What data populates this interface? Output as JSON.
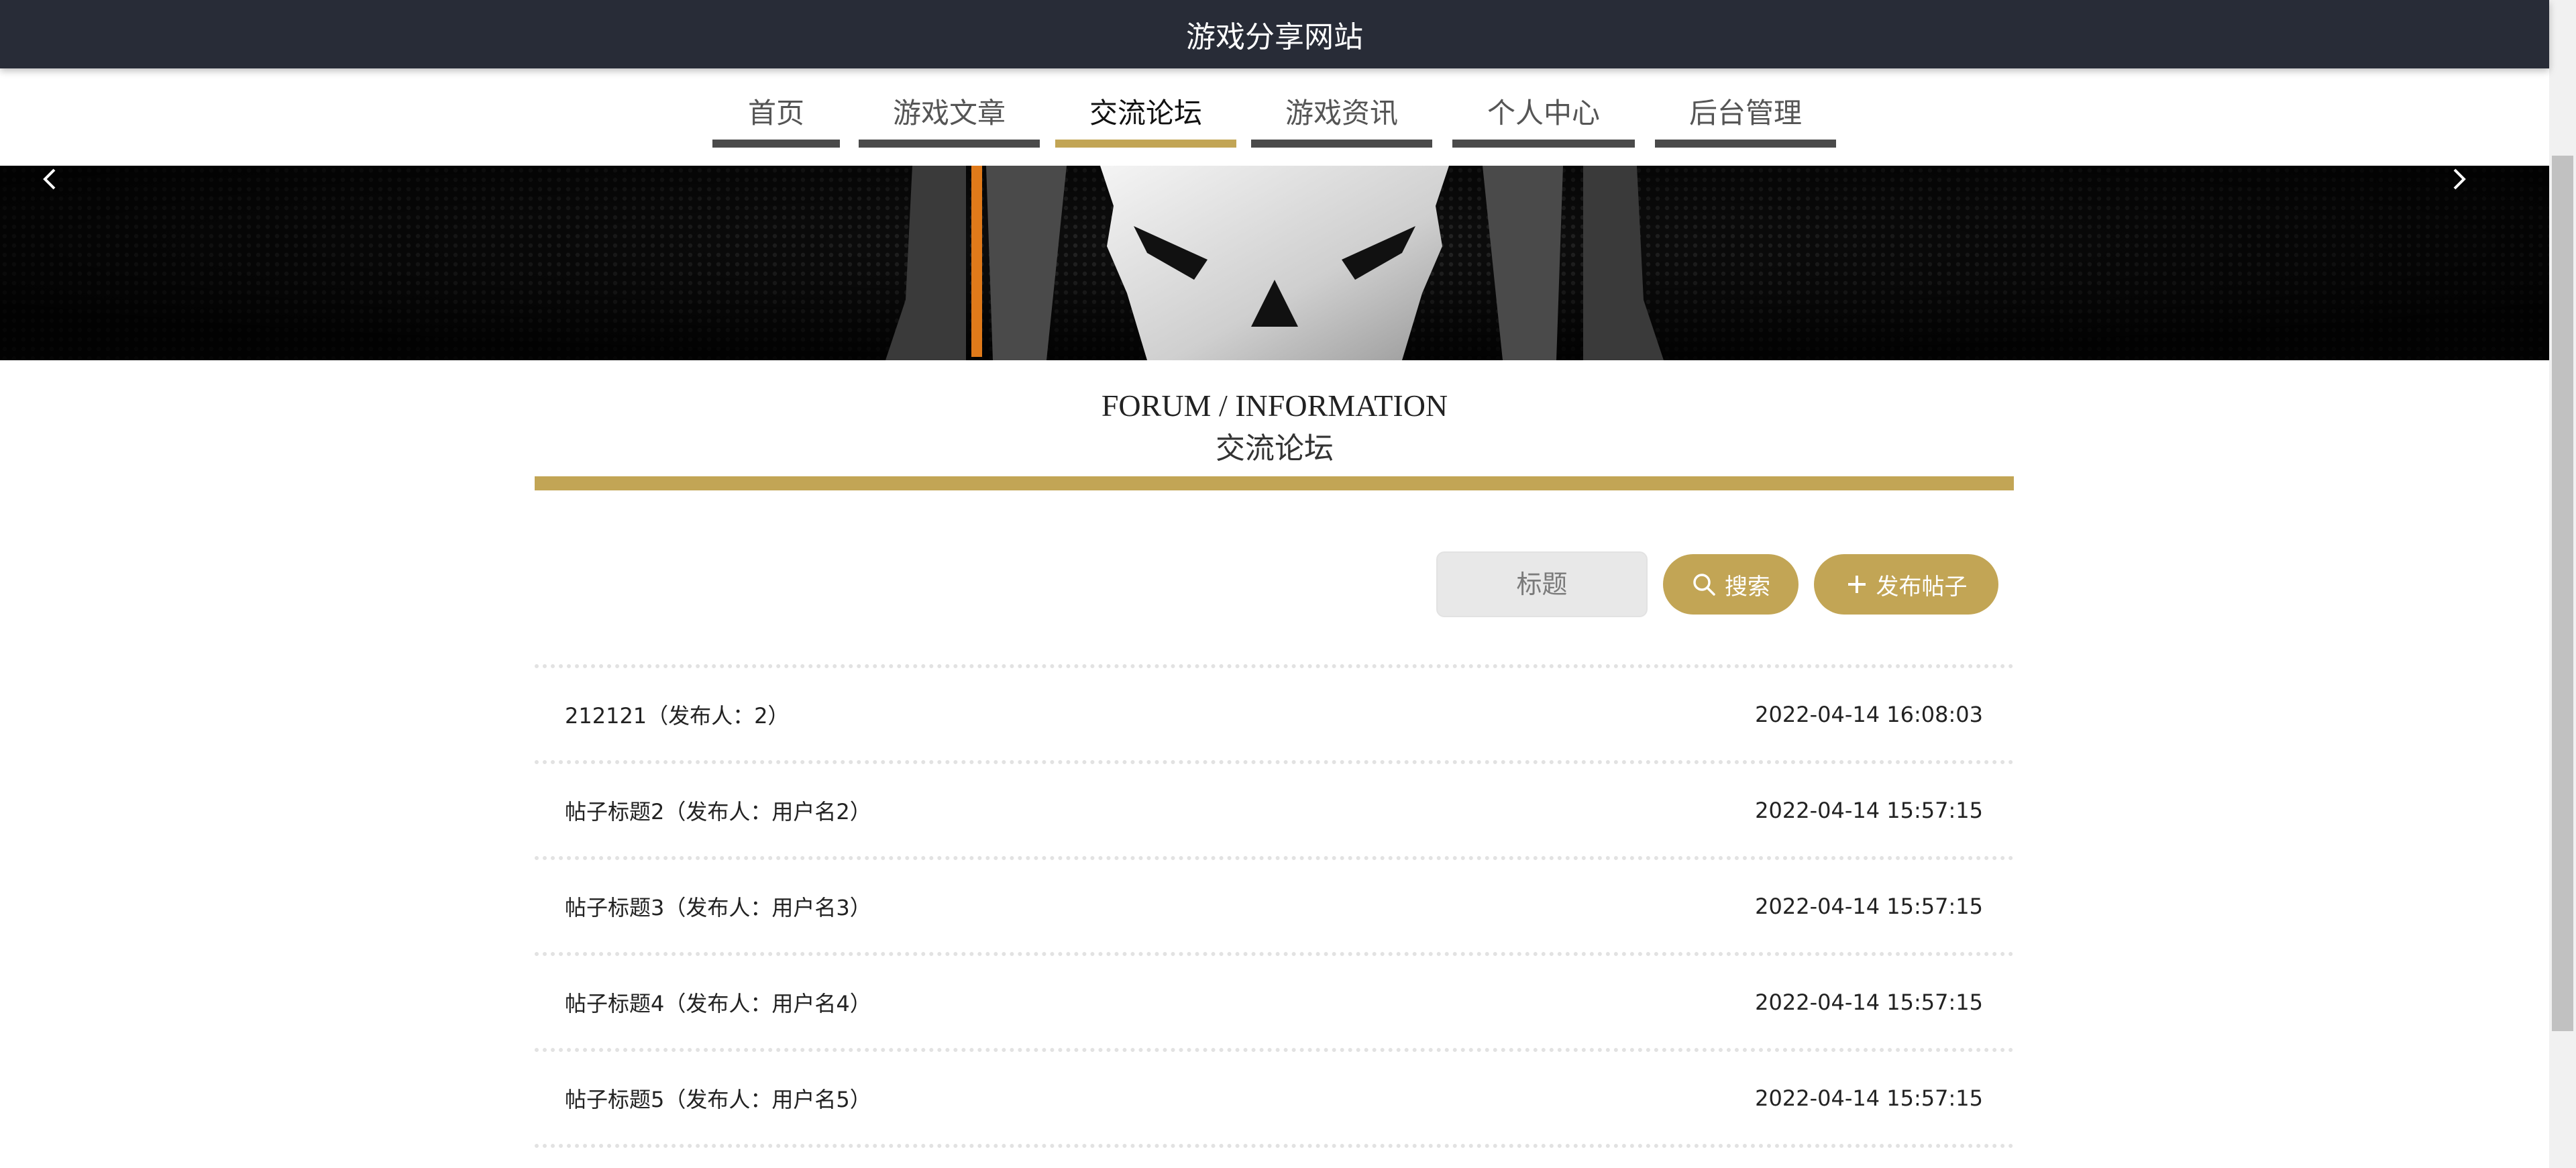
{
  "header": {
    "title": "游戏分享网站"
  },
  "nav": {
    "items": [
      {
        "label": "首页"
      },
      {
        "label": "游戏文章"
      },
      {
        "label": "交流论坛"
      },
      {
        "label": "游戏资讯"
      },
      {
        "label": "个人中心"
      },
      {
        "label": "后台管理"
      }
    ],
    "active_index": 2
  },
  "banner": {
    "prev_icon": "chevron-left-icon",
    "next_icon": "chevron-right-icon"
  },
  "section": {
    "title_en": "FORUM / INFORMATION",
    "title_cn": "交流论坛"
  },
  "search": {
    "placeholder": "标题",
    "value": "",
    "search_label": "搜索",
    "post_label": "发布帖子"
  },
  "posts": [
    {
      "title": "212121（发布人：2）",
      "time": "2022-04-14 16:08:03"
    },
    {
      "title": "帖子标题2（发布人：用户名2）",
      "time": "2022-04-14 15:57:15"
    },
    {
      "title": "帖子标题3（发布人：用户名3）",
      "time": "2022-04-14 15:57:15"
    },
    {
      "title": "帖子标题4（发布人：用户名4）",
      "time": "2022-04-14 15:57:15"
    },
    {
      "title": "帖子标题5（发布人：用户名5）",
      "time": "2022-04-14 15:57:15"
    }
  ],
  "colors": {
    "accent": "#c2a555",
    "header_bg": "#282c37",
    "nav_underline": "#4a4a4a"
  }
}
